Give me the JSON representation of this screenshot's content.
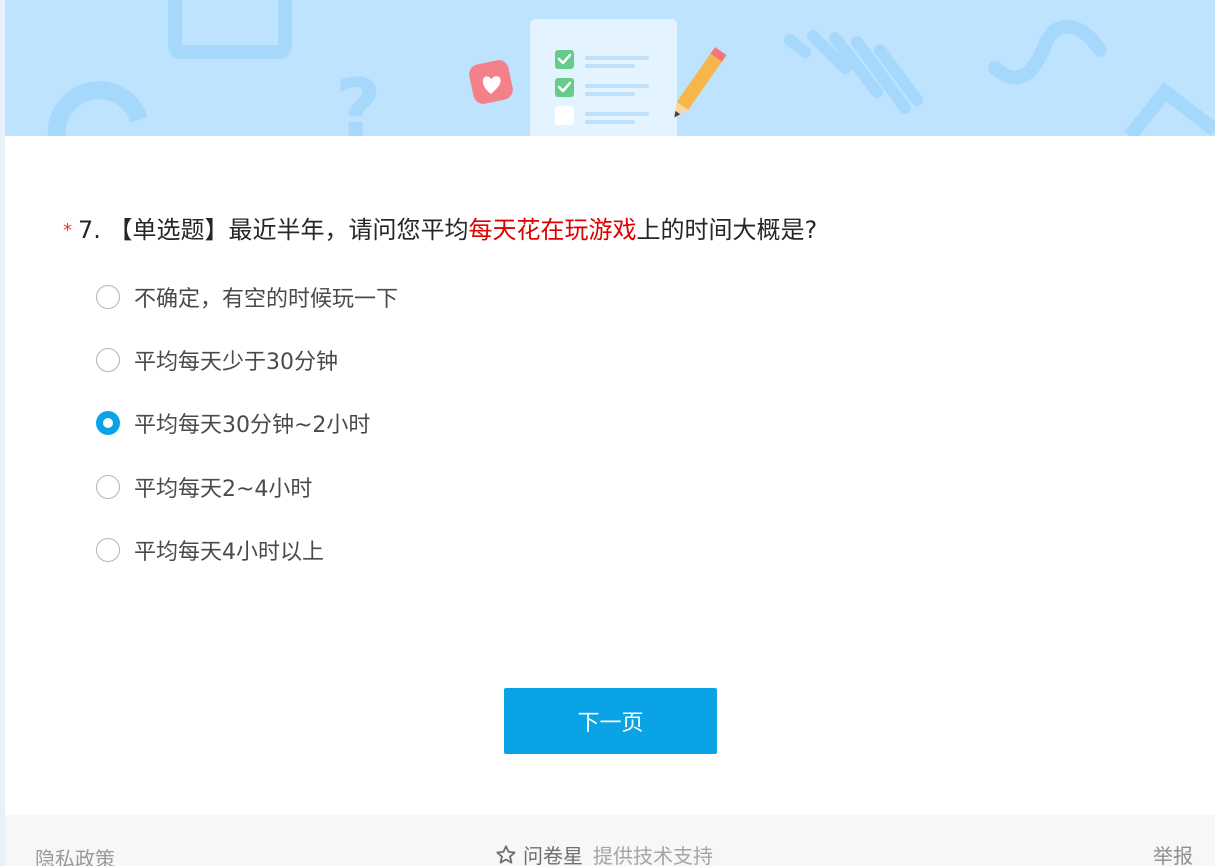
{
  "question": {
    "required_mark": "*",
    "prefix": "7. 【单选题】最近半年，请问您平均",
    "highlight": "每天花在玩游戏",
    "suffix": "上的时间大概是?"
  },
  "options": [
    {
      "label": "不确定，有空的时候玩一下",
      "selected": false
    },
    {
      "label": "平均每天少于30分钟",
      "selected": false
    },
    {
      "label": "平均每天30分钟~2小时",
      "selected": true
    },
    {
      "label": "平均每天2~4小时",
      "selected": false
    },
    {
      "label": "平均每天4小时以上",
      "selected": false
    }
  ],
  "next_button": "下一页",
  "footer": {
    "privacy": "隐私政策",
    "brand": "问卷星",
    "support": "提供技术支持",
    "report": "举报"
  },
  "colors": {
    "accent": "#0aa3e6",
    "highlight": "#e00000",
    "banner": "#bde3fe"
  },
  "icons": [
    "clipboard-checklist-icon",
    "heart-bubble-icon",
    "pencil-icon",
    "star-icon",
    "radio-icon"
  ]
}
